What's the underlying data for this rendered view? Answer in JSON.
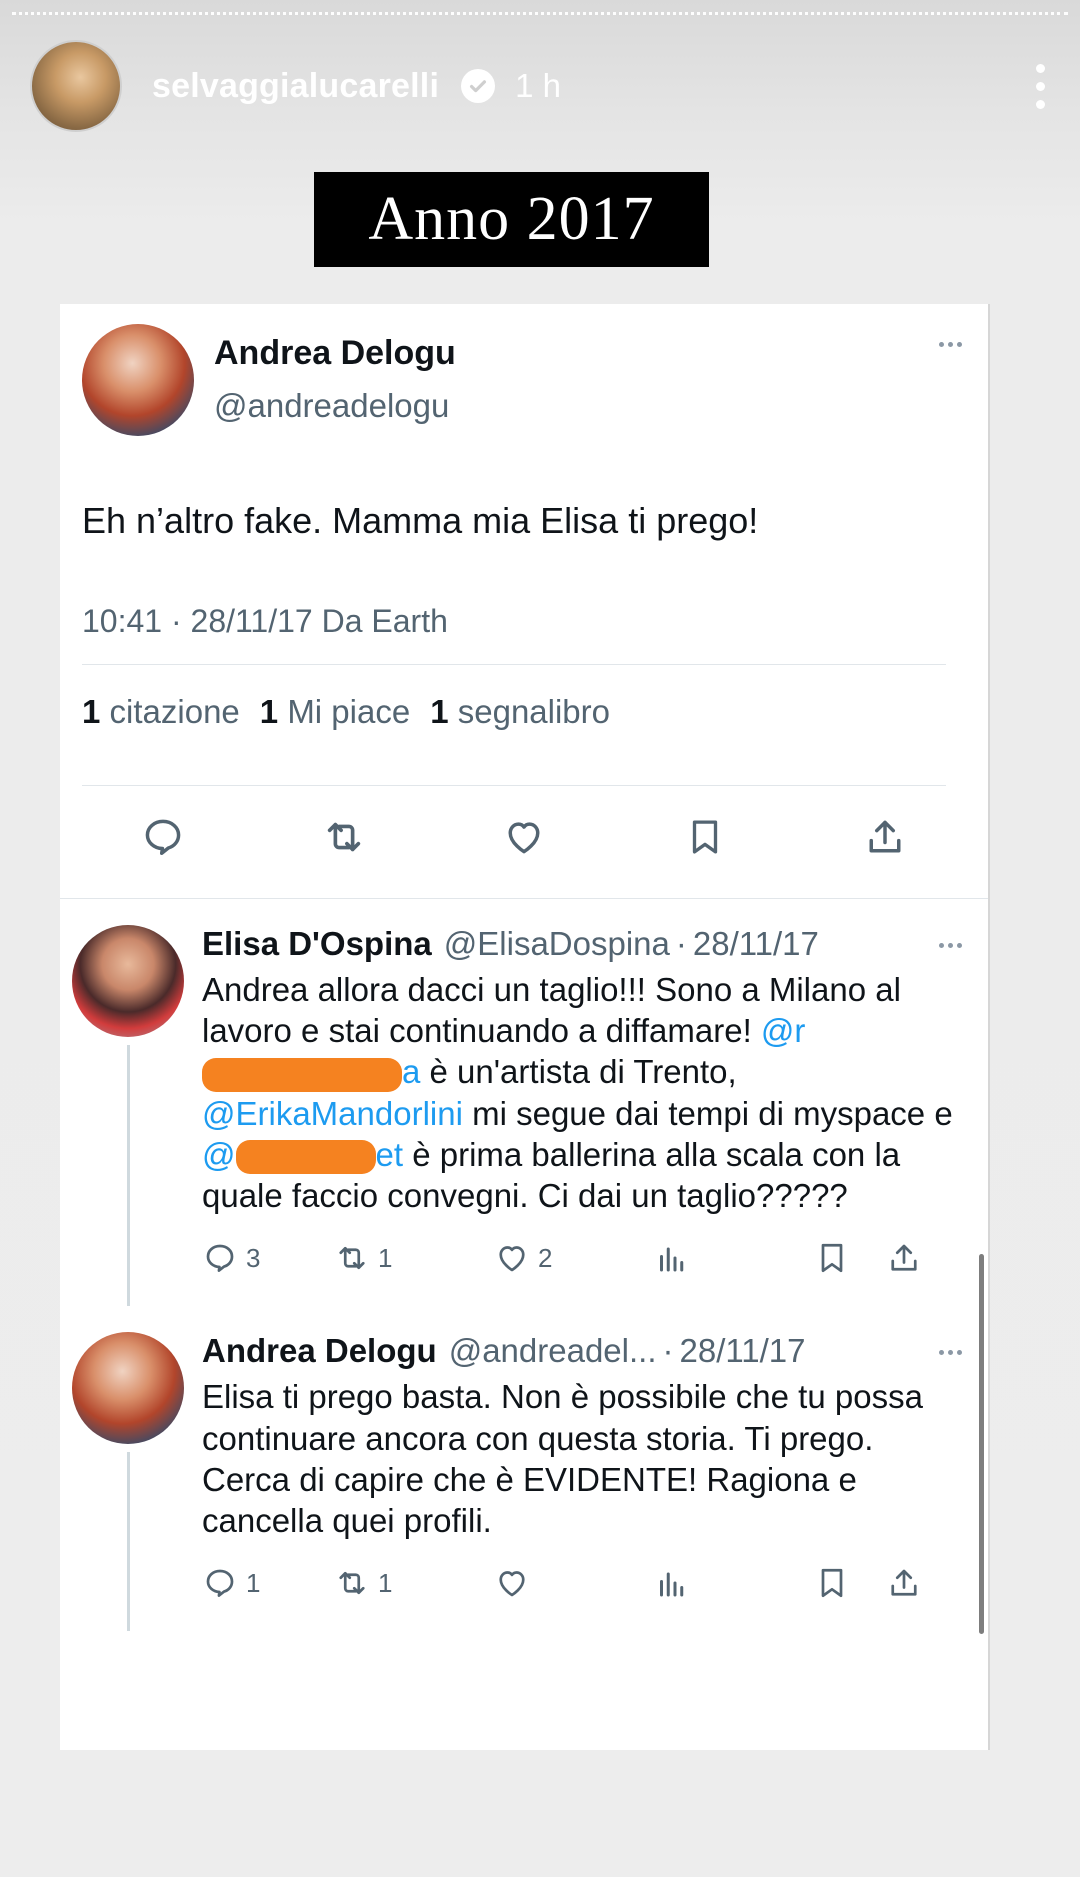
{
  "story": {
    "username": "selvaggialucarelli",
    "time": "1 h",
    "title": "Anno 2017"
  },
  "tweet": {
    "name": "Andrea Delogu",
    "handle": "@andreadelogu",
    "text": "Eh n’altro fake. Mamma mia Elisa ti prego!",
    "meta": "10:41 · 28/11/17 Da Earth",
    "stats": {
      "quotes_count": "1",
      "quotes_label": "citazione",
      "likes_count": "1",
      "likes_label": "Mi piace",
      "bookmarks_count": "1",
      "bookmarks_label": "segnalibro"
    },
    "actions": [
      "reply-icon",
      "retweet-icon",
      "like-icon",
      "bookmark-icon",
      "share-icon"
    ]
  },
  "replies": [
    {
      "name": "Elisa D'Ospina",
      "handle": "@ElisaDospina",
      "date": "28/11/17",
      "text_parts": {
        "p1": "Andrea allora dacci un taglio!!! Sono a Milano al lavoro e stai continuando a diffamare! ",
        "m1_start": "@r",
        "m1_end": "a",
        "p2": " è un'artista di Trento, ",
        "m2": "@ErikaMandorlini",
        "p3": " mi segue dai tempi di myspace e ",
        "m3_start": "@",
        "m3_end": "et",
        "p4": " è prima ballerina alla scala con la quale faccio convegni. Ci dai un taglio?????"
      },
      "replies_count": "3",
      "retweets_count": "1",
      "likes_count": "2"
    },
    {
      "name": "Andrea Delogu",
      "handle": "@andreadel...",
      "date": "28/11/17",
      "text": "Elisa ti prego basta. Non è possibile che tu possa continuare ancora con questa storia. Ti prego. Cerca di capire che è EVIDENTE! Ragiona e cancella quei profili.",
      "replies_count": "1",
      "retweets_count": "1",
      "likes_count": ""
    }
  ],
  "colors": {
    "accent": "#1d9bf0",
    "muted": "#536471",
    "redaction": "#f58220"
  }
}
